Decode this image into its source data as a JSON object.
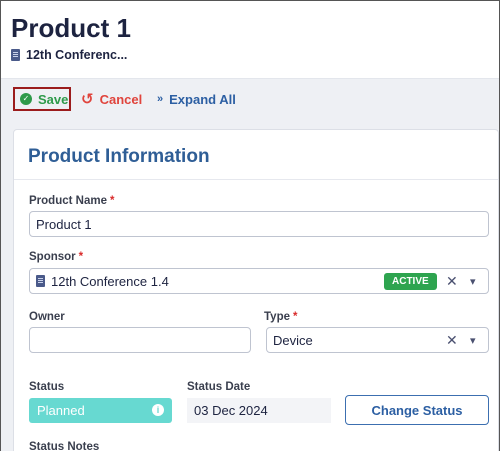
{
  "header": {
    "title": "Product 1",
    "subtitle": "12th Conferenc..."
  },
  "toolbar": {
    "save_label": "Save",
    "cancel_label": "Cancel",
    "expand_label": "Expand All"
  },
  "card": {
    "title": "Product Information",
    "product_name": {
      "label": "Product Name",
      "required": "*",
      "value": "Product 1"
    },
    "sponsor": {
      "label": "Sponsor",
      "required": "*",
      "value": "12th Conference 1.4",
      "badge": "ACTIVE"
    },
    "owner": {
      "label": "Owner",
      "value": ""
    },
    "type": {
      "label": "Type",
      "required": "*",
      "value": "Device"
    },
    "status": {
      "label": "Status",
      "value": "Planned"
    },
    "status_date": {
      "label": "Status Date",
      "value": "03 Dec 2024"
    },
    "change_status_label": "Change Status",
    "status_notes_label": "Status Notes"
  },
  "colors": {
    "save": "#2e9a4a",
    "cancel": "#e0443c",
    "link": "#2c5fa3",
    "active_badge": "#2ea44f",
    "status_planned": "#67d9d1"
  },
  "icons": {
    "save": "check-circle-icon",
    "cancel": "undo-icon",
    "expand": "double-chevron-down-icon",
    "sponsor": "building-icon",
    "clear": "close-icon",
    "dropdown": "chevron-down-icon",
    "info": "info-icon"
  }
}
